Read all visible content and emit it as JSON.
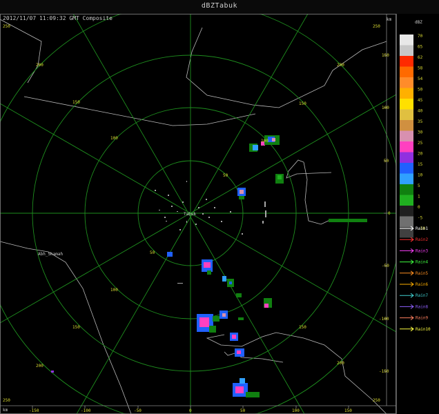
{
  "window": {
    "title": "dBZTabuk"
  },
  "radar": {
    "timestamp": "2012/11/07 11:09:32 GMT Composite",
    "distance_unit": "km",
    "station_label": "Tabuk",
    "place_label": "Abh_Shamah",
    "range_rings_km": [
      50,
      100,
      150,
      200
    ],
    "x_ticks": [
      "-150",
      "-100",
      "-50",
      "0",
      "50",
      "100",
      "150"
    ],
    "y_ticks": [
      "150",
      "100",
      "50",
      "0",
      "-50",
      "-100",
      "-150"
    ],
    "ring_labels": [
      "50",
      "100",
      "150",
      "200",
      "250"
    ],
    "corner_labels": [
      "250",
      "250",
      "250",
      "250"
    ]
  },
  "legend": {
    "unit": "dBZ",
    "scale": [
      {
        "label": "70",
        "color": "#e8e8e8"
      },
      {
        "label": "65",
        "color": "#c8c8c8"
      },
      {
        "label": "62",
        "color": "#ff2a00"
      },
      {
        "label": "58",
        "color": "#ff6a00"
      },
      {
        "label": "54",
        "color": "#ff8c2a"
      },
      {
        "label": "50",
        "color": "#ffb000"
      },
      {
        "label": "45",
        "color": "#ffe000"
      },
      {
        "label": "40",
        "color": "#e0c040"
      },
      {
        "label": "35",
        "color": "#d09040"
      },
      {
        "label": "30",
        "color": "#d890b0"
      },
      {
        "label": "25",
        "color": "#ff40c0"
      },
      {
        "label": "20",
        "color": "#9030e0"
      },
      {
        "label": "15",
        "color": "#2060ff"
      },
      {
        "label": "10",
        "color": "#30a0ff"
      },
      {
        "label": "5",
        "color": "#108010"
      },
      {
        "label": "1",
        "color": "#20b020"
      },
      {
        "label": "0",
        "color": "#202020"
      },
      {
        "label": "-5",
        "color": "#707070"
      },
      {
        "label": "-10",
        "color": "#404040"
      }
    ],
    "rain_tracks": [
      {
        "label": "Rain1",
        "color": "#ffffff"
      },
      {
        "label": "Rain2",
        "color": "#ff3030"
      },
      {
        "label": "Rain3",
        "color": "#ff40ff"
      },
      {
        "label": "Rain4",
        "color": "#40ff40"
      },
      {
        "label": "Rain5",
        "color": "#ff9020"
      },
      {
        "label": "Rain6",
        "color": "#ffb000"
      },
      {
        "label": "Rain7",
        "color": "#40d0d0"
      },
      {
        "label": "Rain8",
        "color": "#9060ff"
      },
      {
        "label": "Rain9",
        "color": "#ff8060"
      },
      {
        "label": "Rain10",
        "color": "#ffff40"
      }
    ]
  }
}
